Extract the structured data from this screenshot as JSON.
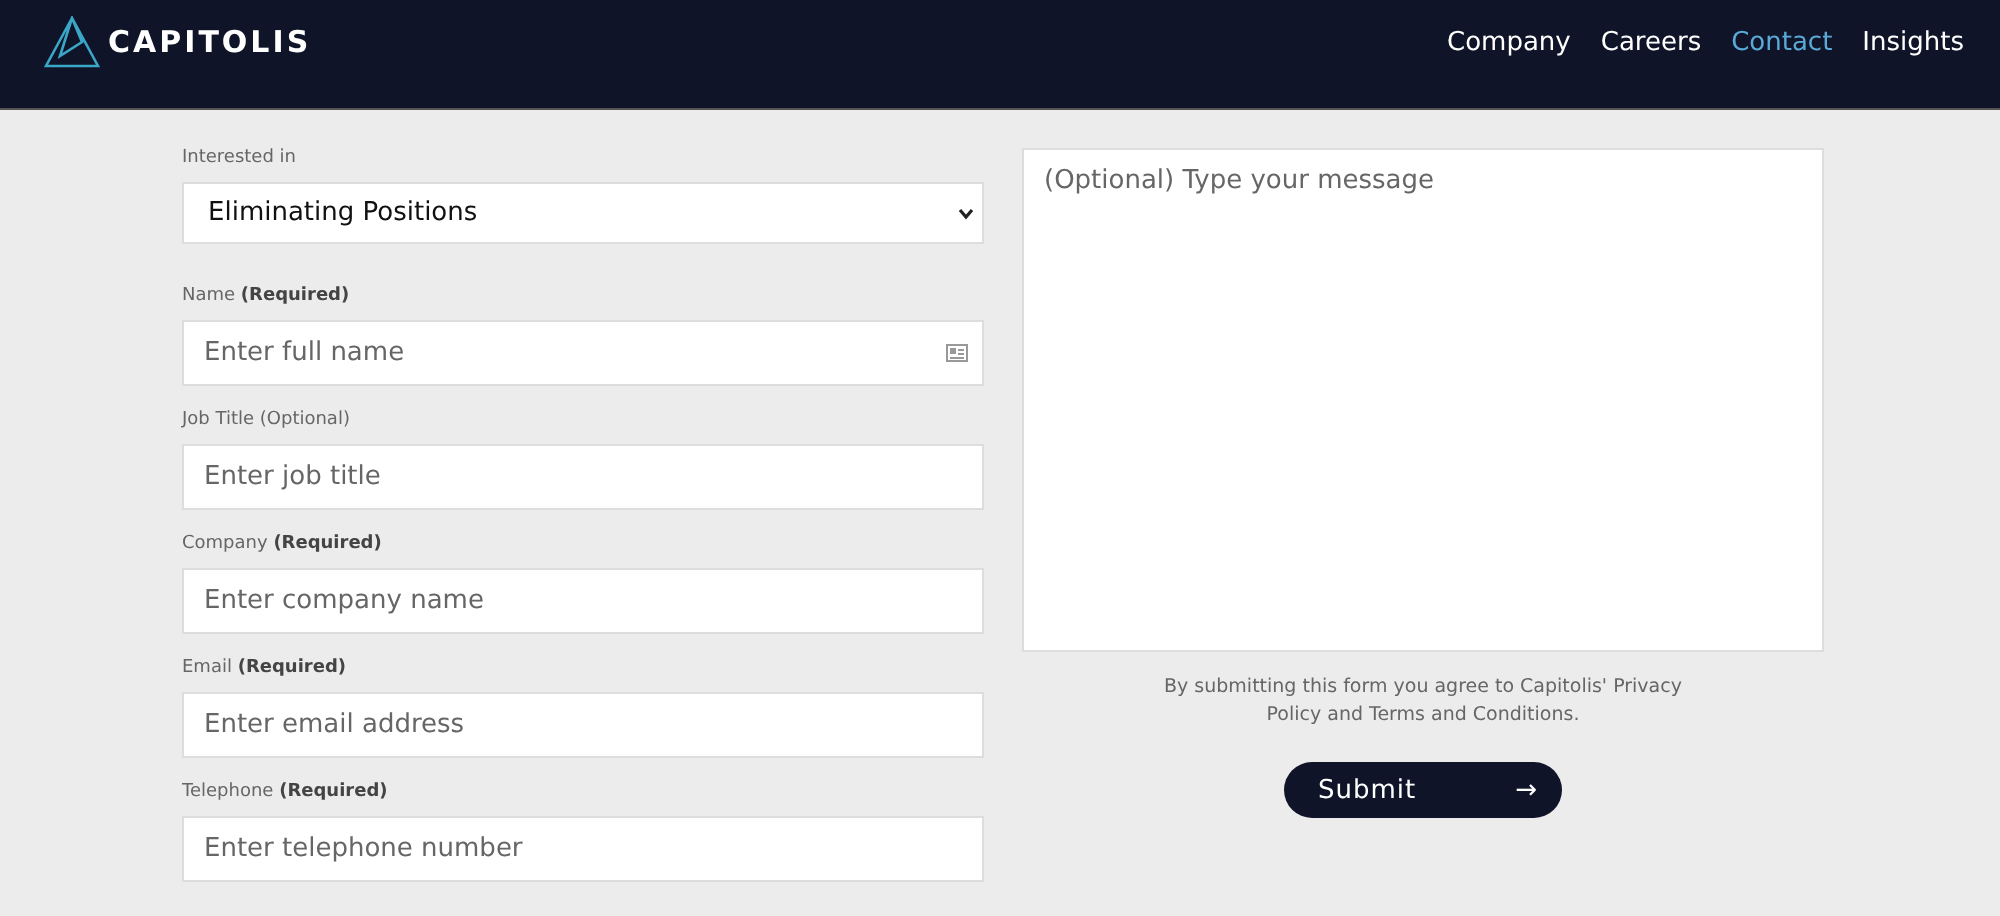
{
  "brand": {
    "name": "CAPITOLIS"
  },
  "nav": [
    {
      "label": "Company",
      "selected": false
    },
    {
      "label": "Careers",
      "selected": false
    },
    {
      "label": "Contact",
      "selected": true
    },
    {
      "label": "Insights",
      "selected": false
    }
  ],
  "fields": [
    {
      "kind": "select",
      "label": "Interested in",
      "value": "Eliminating Positions"
    },
    {
      "kind": "text",
      "label": "Name **(Required)**",
      "placeholder": "Enter full name",
      "autofill_icon": true
    },
    {
      "kind": "text",
      "label": "Job Title (Optional)",
      "placeholder": "Enter job title"
    },
    {
      "kind": "text",
      "label": "Company **(Required)**",
      "placeholder": "Enter company name"
    },
    {
      "kind": "text",
      "label": "Email **(Required)**",
      "placeholder": "Enter email address"
    },
    {
      "kind": "text",
      "label": "Telephone **(Required)**",
      "placeholder": "Enter telephone number"
    }
  ],
  "message": {
    "placeholder": "(Optional) Type your message"
  },
  "disclaimer": "By submitting this form you agree to Capitolis' Privacy Policy and Terms and Conditions.",
  "submit": {
    "label": "Submit",
    "arrow": "→"
  }
}
